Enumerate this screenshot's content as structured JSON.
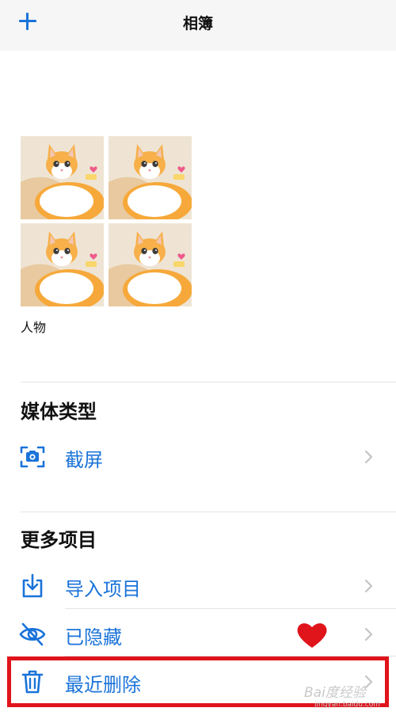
{
  "nav": {
    "title": "相簿",
    "add_icon": "plus-icon",
    "accent_color": "#1a73d9"
  },
  "people": {
    "label": "人物",
    "thumbnails": [
      "cat-photo",
      "cat-photo",
      "cat-photo",
      "cat-photo"
    ]
  },
  "media_types": {
    "title": "媒体类型",
    "items": [
      {
        "label": "截屏",
        "icon": "screenshot-icon"
      }
    ]
  },
  "more_items": {
    "title": "更多项目",
    "items": [
      {
        "label": "导入项目",
        "icon": "import-icon"
      },
      {
        "label": "已隐藏",
        "icon": "eye-hidden-icon"
      },
      {
        "label": "最近删除",
        "icon": "trash-icon"
      }
    ]
  },
  "annotations": {
    "highlight_color": "#e0141b",
    "heart_color": "#e0141b"
  },
  "watermark": {
    "text": "Bai度经验",
    "url": "jingyan.baidu.com"
  }
}
